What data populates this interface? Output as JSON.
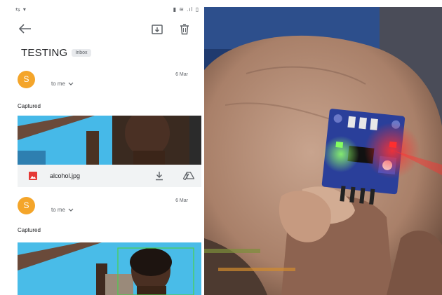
{
  "statusbar": {
    "left": "⇆ ▾",
    "right": "▮ ≋ .ıl ▯"
  },
  "appbar": {
    "back_icon": "arrow-left-icon",
    "archive_icon": "archive-icon",
    "delete_icon": "trash-icon"
  },
  "thread": {
    "subject": "TESTING",
    "label": "Inbox"
  },
  "messages": [
    {
      "sender_initial": "S",
      "recipient": "to me",
      "date": "6 Mar",
      "body": "Captured",
      "attachment": {
        "filename": "alcohol.jpg"
      }
    },
    {
      "sender_initial": "S",
      "recipient": "to me",
      "date": "6 Mar",
      "body": "Captured"
    }
  ],
  "colors": {
    "avatar": "#f4a52a",
    "attachment_bar": "#f1f3f4",
    "image_icon": "#e53935",
    "sensor_board": "#2a3f9a",
    "led_red": "#ff2a2a",
    "led_green": "#7dff5a",
    "face_box": "#4cd04c"
  }
}
